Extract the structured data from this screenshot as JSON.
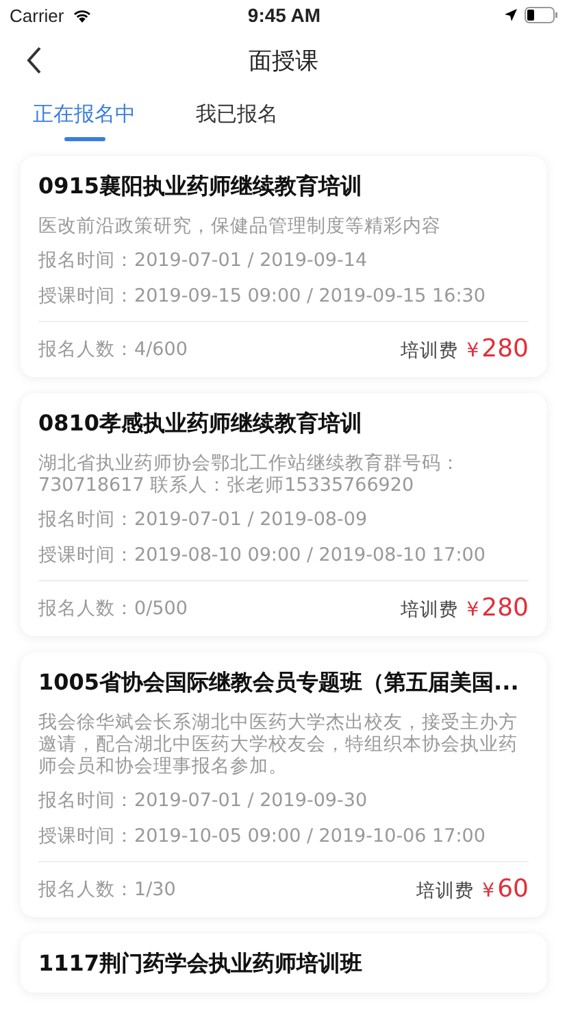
{
  "status_bar": {
    "carrier": "Carrier",
    "time": "9:45 AM"
  },
  "nav": {
    "title": "面授课"
  },
  "tabs": [
    {
      "label": "正在报名中",
      "selected": true
    },
    {
      "label": "我已报名",
      "selected": false
    }
  ],
  "courses": [
    {
      "title": "0915襄阳执业药师继续教育培训",
      "description": "医改前沿政策研究，保健品管理制度等精彩内容",
      "signup_time": "报名时间：2019-07-01 / 2019-09-14",
      "class_time": "授课时间：2019-09-15 09:00 / 2019-09-15 16:30",
      "enrolled": "报名人数：4/600",
      "fee_label": "培训费",
      "currency": "¥",
      "fee": "280"
    },
    {
      "title": "0810孝感执业药师继续教育培训",
      "description": "湖北省执业药师协会鄂北工作站继续教育群号码：730718617   联系人：张老师15335766920",
      "signup_time": "报名时间：2019-07-01 / 2019-08-09",
      "class_time": "授课时间：2019-08-10 09:00 / 2019-08-10 17:00",
      "enrolled": "报名人数：0/500",
      "fee_label": "培训费",
      "currency": "¥",
      "fee": "280"
    },
    {
      "title": "1005省协会国际继教会员专题班（第五届美国...",
      "description": "我会徐华斌会长系湖北中医药大学杰出校友，接受主办方邀请，配合湖北中医药大学校友会，特组织本协会执业药师会员和协会理事报名参加。",
      "signup_time": "报名时间：2019-07-01 / 2019-09-30",
      "class_time": "授课时间：2019-10-05 09:00 / 2019-10-06 17:00",
      "enrolled": "报名人数：1/30",
      "fee_label": "培训费",
      "currency": "¥",
      "fee": "60"
    },
    {
      "title": "1117荆门药学会执业药师培训班"
    }
  ]
}
